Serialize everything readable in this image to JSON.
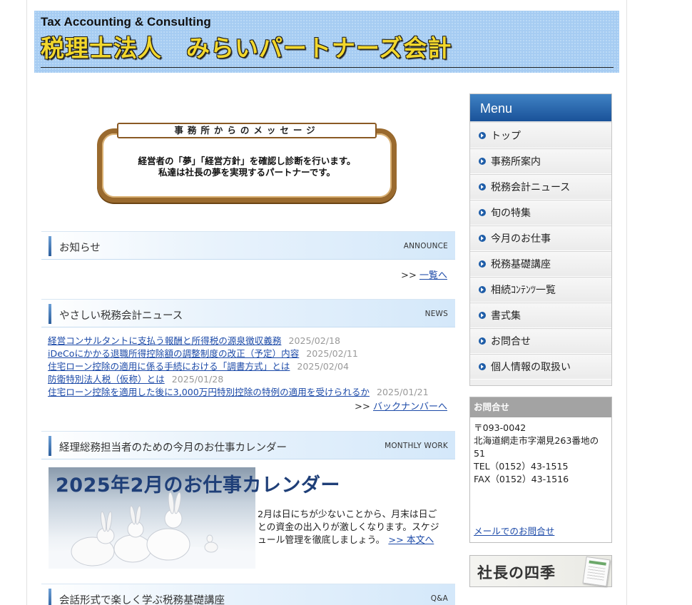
{
  "header": {
    "english_title": "Tax Accounting & Consulting",
    "japanese_title": "税理士法人　みらいパートナーズ会計"
  },
  "message": {
    "ribbon": "事務所からのメッセージ",
    "line1": "経営者の「夢」「経営方針」を確認し診断を行います。",
    "line2": "私達は社長の夢を実現するパートナーです。"
  },
  "announce": {
    "title": "お知らせ",
    "tag": "ANNOUNCE",
    "more_prefix": ">>",
    "more_label": "一覧へ"
  },
  "news": {
    "title": "やさしい税務会計ニュース",
    "tag": "NEWS",
    "items": [
      {
        "title": "経営コンサルタントに支払う報酬と所得税の源泉徴収義務",
        "date": "2025/02/18"
      },
      {
        "title": "iDeCoにかかる退職所得控除額の調整制度の改正（予定）内容",
        "date": "2025/02/11"
      },
      {
        "title": "住宅ローン控除の適用に係る手続における「調書方式」とは",
        "date": "2025/02/04"
      },
      {
        "title": "防衛特別法人税（仮称）とは",
        "date": "2025/01/28"
      },
      {
        "title": "住宅ローン控除を適用した後に3,000万円特別控除の特例の適用を受けられるか",
        "date": "2025/01/21"
      }
    ],
    "more_prefix": ">>",
    "more_label": "バックナンバーへ"
  },
  "monthly": {
    "title": "経理総務担当者のための今月のお仕事カレンダー",
    "tag": "MONTHLY WORK",
    "image_title": "2025年2月のお仕事カレンダー",
    "text": "2月は日にちが少ないことから、月末は日ごとの資金の出入りが激しくなります。スケジュール管理を徹底しましょう。",
    "more_label": ">> 本文へ"
  },
  "qa": {
    "title": "会話形式で楽しく学ぶ税務基礎講座",
    "tag": "Q&A"
  },
  "menu": {
    "title": "Menu",
    "items": [
      {
        "label": "トップ"
      },
      {
        "label": "事務所案内"
      },
      {
        "label": "税務会計ニュース"
      },
      {
        "label": "旬の特集"
      },
      {
        "label": "今月のお仕事"
      },
      {
        "label": "税務基礎講座"
      },
      {
        "label": "相続ｺﾝﾃﾝﾂ一覧"
      },
      {
        "label": "書式集"
      },
      {
        "label": "お問合せ"
      },
      {
        "label": "個人情報の取扱い"
      }
    ]
  },
  "contact": {
    "title": "お問合せ",
    "postal": "〒093-0042",
    "address": "北海道網走市字潮見263番地の51",
    "tel": "TEL（0152）43-1515",
    "fax": "FAX（0152）43-1516",
    "mail_label": "メールでのお問合せ"
  },
  "season_banner": {
    "label": "社長の四季"
  }
}
